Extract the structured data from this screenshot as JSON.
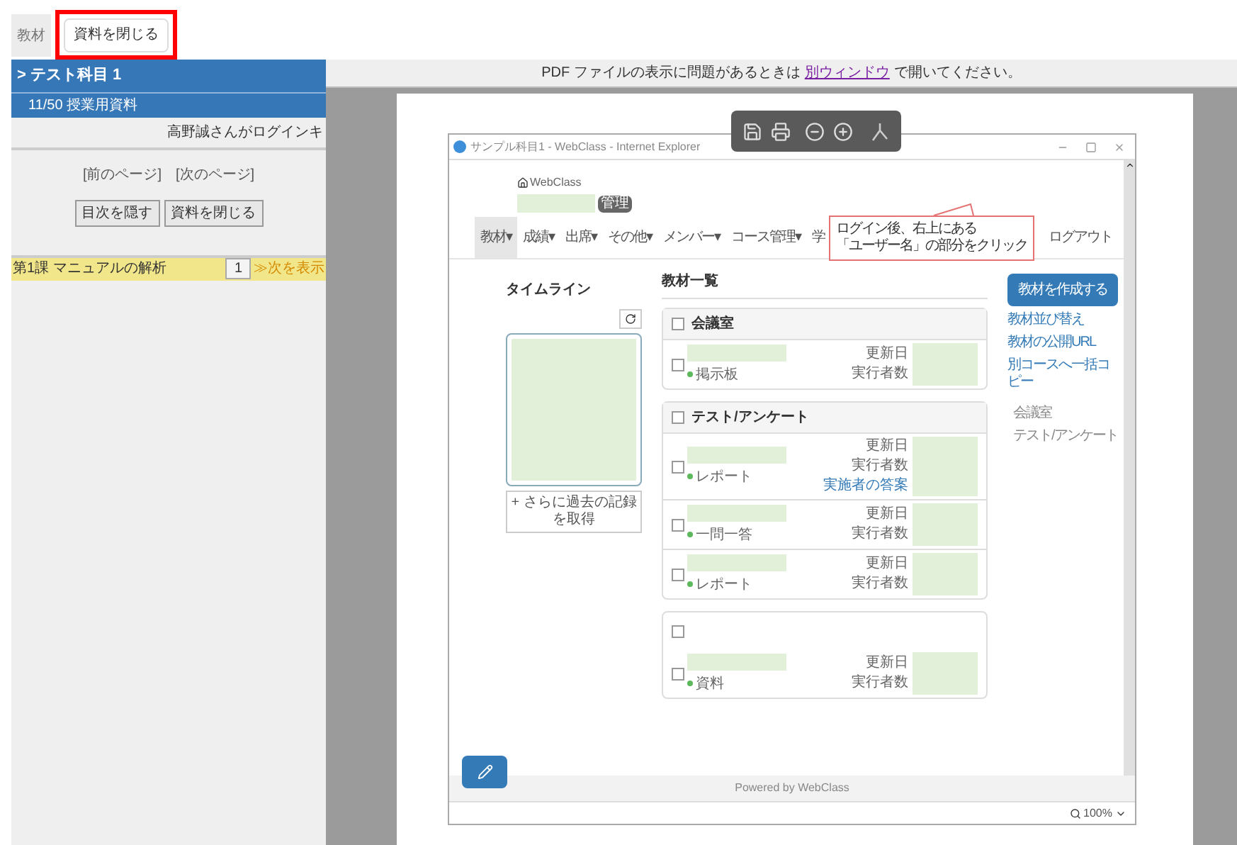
{
  "top_bar": {
    "tab": "教材",
    "close_button": "資料を閉じる",
    "highlighted": true
  },
  "sidebar": {
    "title": "> テスト科目 1",
    "subtitle": "11/50 授業用資料",
    "login_note": "高野誠さんがログインキ",
    "prev_page": "[前のページ]",
    "next_page": "[次のページ]",
    "buttons": [
      "目次を隠す",
      "資料を閉じる"
    ],
    "chapter": {
      "title": "第1課 マニュアルの解析",
      "page": "1",
      "jump": "≫次を表示"
    }
  },
  "viewer": {
    "notice": {
      "before": "PDF ファイルの表示に問題があるときは",
      "link": "別ウィンドウ",
      "after": "で開いてください。"
    }
  },
  "document": {
    "window_title": "サンプル科目1 - WebClass - Internet Explorer",
    "home": "WebClass",
    "badge": "管理",
    "nav": [
      {
        "label": "教材▾",
        "selected": true
      },
      {
        "label": "成績▾",
        "selected": false
      },
      {
        "label": "出席▾",
        "selected": false
      },
      {
        "label": "その他▾",
        "selected": false
      },
      {
        "label": "メンバー▾",
        "selected": false
      },
      {
        "label": "コース管理▾",
        "selected": false
      },
      {
        "label": "学",
        "selected": false
      }
    ],
    "logout": "ログアウト",
    "callout": [
      "ログイン後、右上にある",
      "「ユーザー名」の部分をクリック"
    ],
    "timeline": {
      "title": "タイムライン",
      "more": "+ さらに過去の記録を取得"
    },
    "materials": {
      "title": "教材一覧",
      "groups": [
        {
          "title": "会議室",
          "checked": false,
          "items": [
            {
              "type": "掲示板",
              "checked": false,
              "fields": [
                "更新日",
                "実行者数"
              ]
            }
          ]
        },
        {
          "title": "テスト/アンケート",
          "checked": false,
          "items": [
            {
              "type": "レポート",
              "checked": false,
              "fields": [
                "更新日",
                "実行者数"
              ],
              "link": "実施者の答案"
            },
            {
              "type": "一問一答",
              "checked": false,
              "fields": [
                "更新日",
                "実行者数"
              ]
            },
            {
              "type": "レポート",
              "checked": false,
              "fields": [
                "更新日",
                "実行者数"
              ]
            }
          ]
        },
        {
          "checked": false,
          "items": [
            {
              "type": "資料",
              "checked": false,
              "fields": [
                "更新日",
                "実行者数"
              ]
            }
          ]
        }
      ]
    },
    "actions": {
      "create": "教材を作成する",
      "links": [
        "教材並び替え",
        "教材の公開URL",
        "別コースへ一括コピー"
      ],
      "categories": [
        "会議室",
        "テスト/アンケート"
      ]
    },
    "footer": "Powered by WebClass",
    "zoom": "100%"
  }
}
